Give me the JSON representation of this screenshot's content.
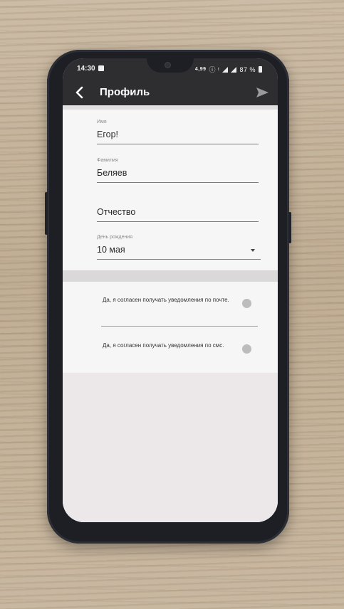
{
  "status_bar": {
    "time": "14:30",
    "network": "4,99",
    "icons": "ⓘ ᵗ",
    "battery": "87 %"
  },
  "app_bar": {
    "title": "Профиль"
  },
  "form": {
    "first_name": {
      "label": "Имя",
      "value": "Егор!"
    },
    "last_name": {
      "label": "Фамилия",
      "value": "Беляев"
    },
    "patronymic": {
      "label": "",
      "value": "Отчество"
    },
    "birthday": {
      "label": "День рождения",
      "value": "10 мая"
    }
  },
  "consents": {
    "email": {
      "label": "Да, я согласен получать уведомления по почте."
    },
    "sms": {
      "label": "Да, я согласен получать уведомления по смс."
    }
  },
  "colors": {
    "app_bar": "#2e2e30",
    "card": "#f6f6f6",
    "background": "#ece8ea",
    "toggle_off": "#bcbcbc"
  }
}
